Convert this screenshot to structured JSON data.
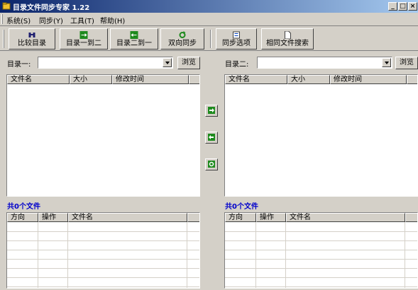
{
  "window": {
    "title": "目录文件同步专家 1.22",
    "minimize": "_",
    "maximize": "□",
    "close": "×"
  },
  "menu": {
    "items": [
      "系统(S)",
      "同步(Y)",
      "工具(T)",
      "帮助(H)"
    ]
  },
  "toolbar": {
    "compare_label": "比较目录",
    "one_to_two_label": "目录一到二",
    "two_to_one_label": "目录二到一",
    "two_way_label": "双向同步",
    "options_label": "同步选项",
    "search_label": "相同文件搜索"
  },
  "dir_one": {
    "label": "目录一:",
    "value": "",
    "browse_label": "浏览"
  },
  "dir_two": {
    "label": "目录二:",
    "value": "",
    "browse_label": "浏览"
  },
  "file_list": {
    "columns": [
      "文件名",
      "大小",
      "修改时间"
    ]
  },
  "left_count": "共0个文件",
  "right_count": "共0个文件",
  "ops_list": {
    "columns": [
      "方向",
      "操作",
      "文件名"
    ]
  },
  "colors": {
    "titlebar_start": "#0a246a",
    "titlebar_end": "#a6caf0",
    "count_text": "#0000cc",
    "arrow_green": "#1e8a1e"
  }
}
